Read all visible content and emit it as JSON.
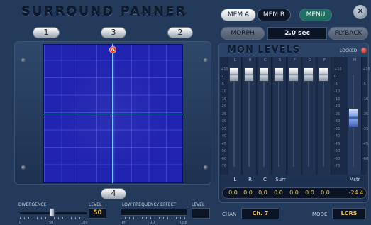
{
  "header": {
    "title": "SURROUND PANNER",
    "speakers": [
      "1",
      "3",
      "2"
    ],
    "bottom_speaker": "4"
  },
  "memory": {
    "mem_a": "MEM A",
    "mem_b": "MEM B",
    "menu": "MENU"
  },
  "morph": {
    "label": "MORPH",
    "time": "2.0 sec",
    "flyback": "FLYBACK"
  },
  "pan": {
    "marker": "A",
    "marker_position": {
      "x": 0.5,
      "y": 0.0
    }
  },
  "divergence": {
    "label": "DIVERGENCE",
    "level_label": "LEVEL",
    "value": "50",
    "ticks": [
      "0",
      "50",
      "100"
    ]
  },
  "lfe": {
    "label": "LOW FREQUENCY EFFECT",
    "level_label": "LEVEL",
    "ticks": [
      "-inf",
      "-10",
      "0dB"
    ]
  },
  "mon_levels": {
    "title": "MON LEVELS",
    "locked_label": "LOCKED",
    "strip_headers": [
      "L",
      "R",
      "C",
      "S",
      "F",
      "G",
      "F",
      "M"
    ],
    "channels": [
      "L",
      "R",
      "C",
      "Surr",
      "",
      "",
      "",
      "Mstr"
    ],
    "values": [
      "0.0",
      "0.0",
      "0.0",
      "0.0",
      "0.0",
      "0.0",
      "0.0",
      "-24.4"
    ],
    "scale": [
      "+10",
      "0",
      "-5",
      "-10",
      "-15",
      "-20",
      "-25",
      "-30",
      "-35",
      "-40",
      "-45",
      "-50",
      "-60",
      "-70"
    ]
  },
  "footer": {
    "chan_label": "CHAN",
    "chan_value": "Ch. 7",
    "mode_label": "MODE",
    "mode_value": "LCRS"
  },
  "colors": {
    "background": "#243a5a",
    "grid": "#1f23b0",
    "crosshair": "#6ad0ff",
    "value_text": "#f0c84a",
    "menu_button": "#1e6e62"
  }
}
